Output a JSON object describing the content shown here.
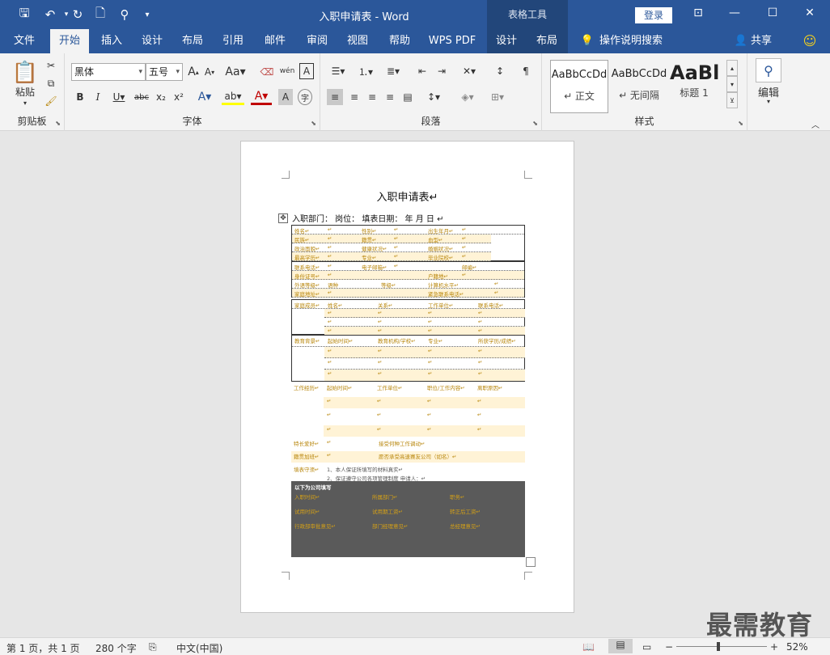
{
  "titlebar": {
    "title": "入职申请表  -  Word",
    "context_tab": "表格工具",
    "login": "登录",
    "min": "—",
    "restore": "☐",
    "close": "✕",
    "ribbon_opts": "⊡"
  },
  "tabs": [
    "文件",
    "开始",
    "插入",
    "设计",
    "布局",
    "引用",
    "邮件",
    "审阅",
    "视图",
    "帮助",
    "WPS PDF",
    "设计",
    "布局"
  ],
  "tell_me": "操作说明搜索",
  "share": "共享",
  "ribbon": {
    "clipboard": {
      "label": "剪贴板",
      "paste": "粘贴"
    },
    "font": {
      "label": "字体",
      "font_name": "黑体",
      "font_size": "五号"
    },
    "paragraph": {
      "label": "段落"
    },
    "styles": {
      "label": "样式",
      "items": [
        {
          "sample": "AaBbCcDd",
          "name": "↵ 正文"
        },
        {
          "sample": "AaBbCcDd",
          "name": "↵ 无间隔"
        },
        {
          "sample": "AaBl",
          "name": "标题 1"
        }
      ]
    },
    "editing": {
      "label": "编辑"
    }
  },
  "doc": {
    "title": "入职申请表↵",
    "header_line": "入职部门：     岗位：     填表日期：     年     月     日         ↵",
    "sec1": [
      [
        "姓名↵",
        "↵",
        "性别↵",
        "↵",
        "出生年月↵",
        "↵"
      ],
      [
        "民族↵",
        "↵",
        "籍贯↵",
        "↵",
        "血型↵",
        "↵"
      ],
      [
        "政治面貌↵",
        "↵",
        "健康状况↵",
        "↵",
        "婚姻状况↵",
        "↵"
      ],
      [
        "最高学历↵",
        "↵",
        "专业↵",
        "↵",
        "毕业院校↵",
        "↵"
      ]
    ],
    "sec2": [
      [
        "联系电话↵",
        "↵",
        "电子邮箱↵",
        "↵",
        "",
        "邮编↵"
      ],
      [
        "身份证号↵",
        "↵",
        "",
        "",
        "户籍地↵",
        "↵"
      ],
      [
        "外语等级↵",
        "语种",
        "",
        "等级↵",
        "计算机水平↵",
        "↵"
      ],
      [
        "家庭地址↵",
        "↵",
        "",
        "",
        "紧急联系电话↵",
        "↵"
      ]
    ],
    "sec3": [
      [
        "家庭成员↵",
        "姓名↵",
        "关系↵",
        "工作单位↵",
        "联系电话↵"
      ],
      [
        "",
        "↵",
        "↵",
        "↵",
        "↵"
      ],
      [
        "",
        "↵",
        "↵",
        "↵",
        "↵"
      ],
      [
        "",
        "↵",
        "↵",
        "↵",
        "↵"
      ]
    ],
    "sec4": [
      [
        "教育背景↵",
        "起始时间↵",
        "教育机构/学校↵",
        "专业↵",
        "所获学历/成绩↵"
      ],
      [
        "",
        "↵",
        "↵",
        "↵",
        "↵"
      ],
      [
        "",
        "↵",
        "↵",
        "↵",
        "↵"
      ],
      [
        "",
        "↵",
        "↵",
        "↵",
        "↵"
      ]
    ],
    "work": [
      [
        "工作经历↵",
        "起始时间↵",
        "工作单位↵",
        "职位/工作内容↵",
        "离职原因↵"
      ],
      [
        "",
        "↵",
        "↵",
        "↵",
        "↵"
      ],
      [
        "",
        "↵",
        "↵",
        "↵",
        "↵"
      ],
      [
        "",
        "↵",
        "↵",
        "↵",
        "↵"
      ]
    ],
    "extra": [
      [
        "特长爱好↵",
        "↵",
        "接受何种工作调动↵"
      ],
      [
        "籍贯加班↵",
        "↵",
        "愿否承受高速赛友公司（如名）↵"
      ]
    ],
    "notes_label": "填表守须↵",
    "notes": [
      "1、本人保证所填写的材料真实↵",
      "2、保证遵守公司各项管理制度        申请人：↵"
    ],
    "company": {
      "header": "以下为公司填写",
      "rows": [
        [
          "入职时间↵",
          "所属部门↵",
          "职务↵"
        ],
        [
          "试用时间↵",
          "试用期工资↵",
          "转正后工资↵"
        ],
        [
          "行政部审批意见↵",
          "部门经理意见↵",
          "总经理意见↵"
        ]
      ]
    }
  },
  "status": {
    "page": "第 1 页，共 1 页",
    "words": "280 个字",
    "lang": "中文(中国)",
    "zoom": "52%",
    "minus": "−",
    "plus": "+"
  },
  "watermark": "最需教育",
  "colors": {
    "brand": "#2b579a",
    "highlight": "#fff3d6",
    "field_text": "#b8860b"
  }
}
